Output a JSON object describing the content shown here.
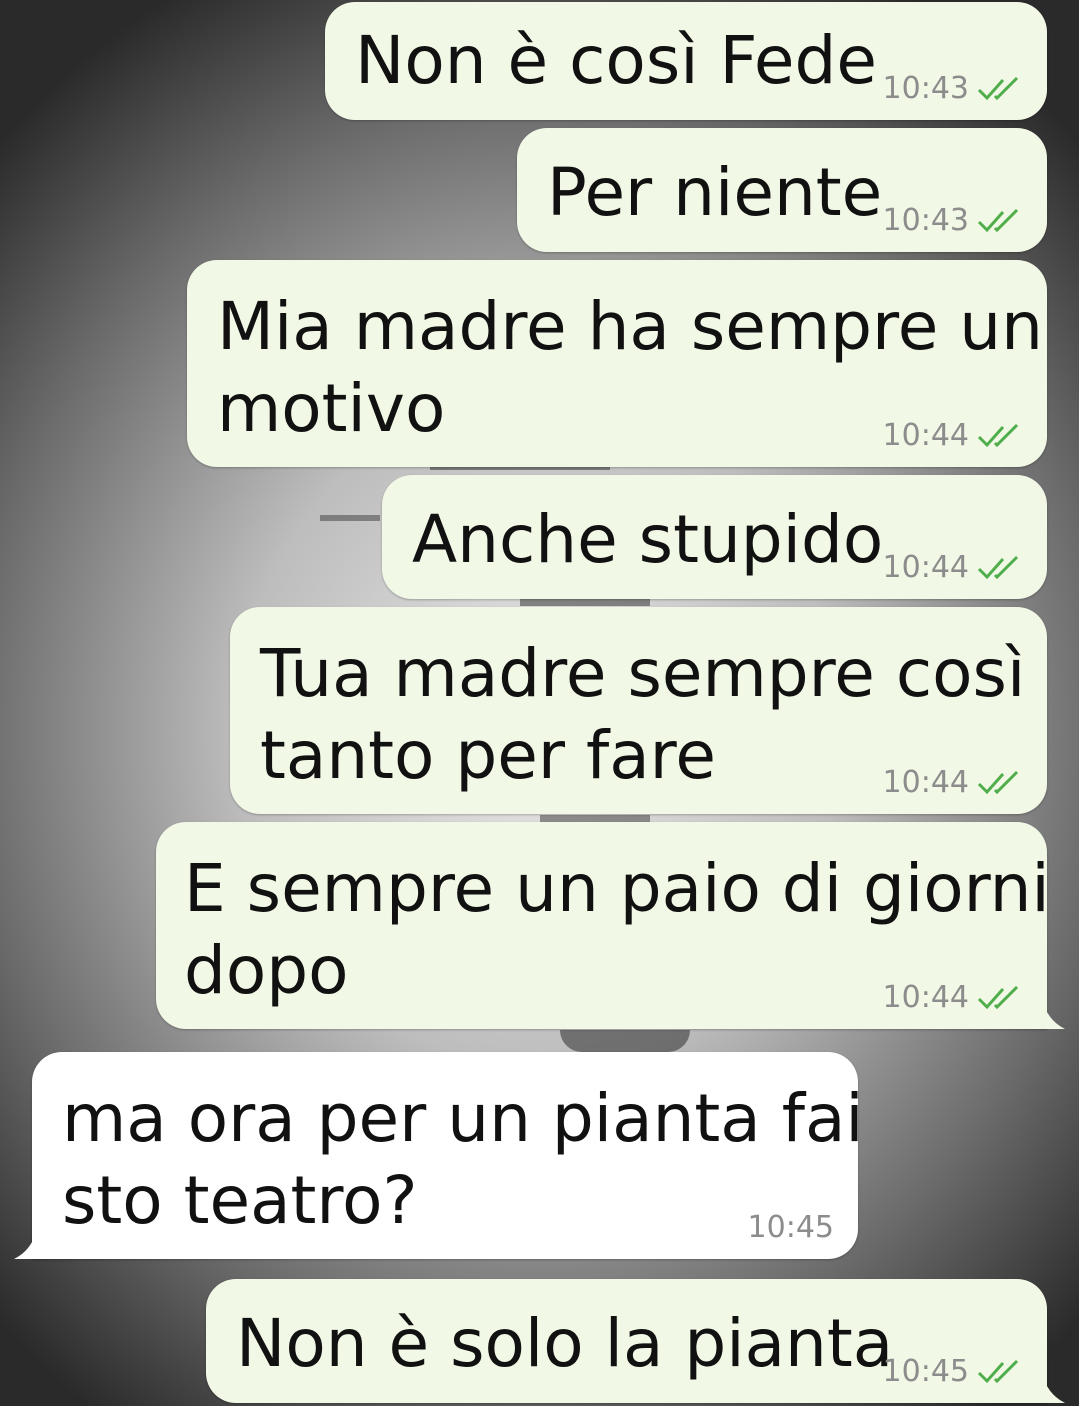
{
  "conversation": {
    "messages": [
      {
        "direction": "outgoing",
        "lines": [
          "Non è così Fede"
        ],
        "time": "10:43",
        "status": "read"
      },
      {
        "direction": "outgoing",
        "lines": [
          "Per niente"
        ],
        "time": "10:43",
        "status": "read"
      },
      {
        "direction": "outgoing",
        "lines": [
          "Mia madre ha sempre un",
          "motivo"
        ],
        "time": "10:44",
        "status": "read"
      },
      {
        "direction": "outgoing",
        "lines": [
          "Anche stupido"
        ],
        "time": "10:44",
        "status": "read"
      },
      {
        "direction": "outgoing",
        "lines": [
          "Tua madre sempre così",
          "tanto per fare"
        ],
        "time": "10:44",
        "status": "read"
      },
      {
        "direction": "outgoing",
        "lines": [
          "E sempre un paio di giorni",
          "dopo"
        ],
        "time": "10:44",
        "status": "read"
      },
      {
        "direction": "incoming",
        "lines": [
          "ma ora per un pianta fai",
          "sto teatro?"
        ],
        "time": "10:45"
      },
      {
        "direction": "outgoing",
        "lines": [
          "Non è solo la pianta"
        ],
        "time": "10:45",
        "status": "read"
      }
    ]
  },
  "colors": {
    "outgoing_bubble": "#f1f8e6",
    "incoming_bubble": "#ffffff",
    "read_tick": "#4fae4a",
    "timestamp": "#8c8c8c"
  },
  "icons": {
    "read_receipt": "double-check-icon"
  }
}
